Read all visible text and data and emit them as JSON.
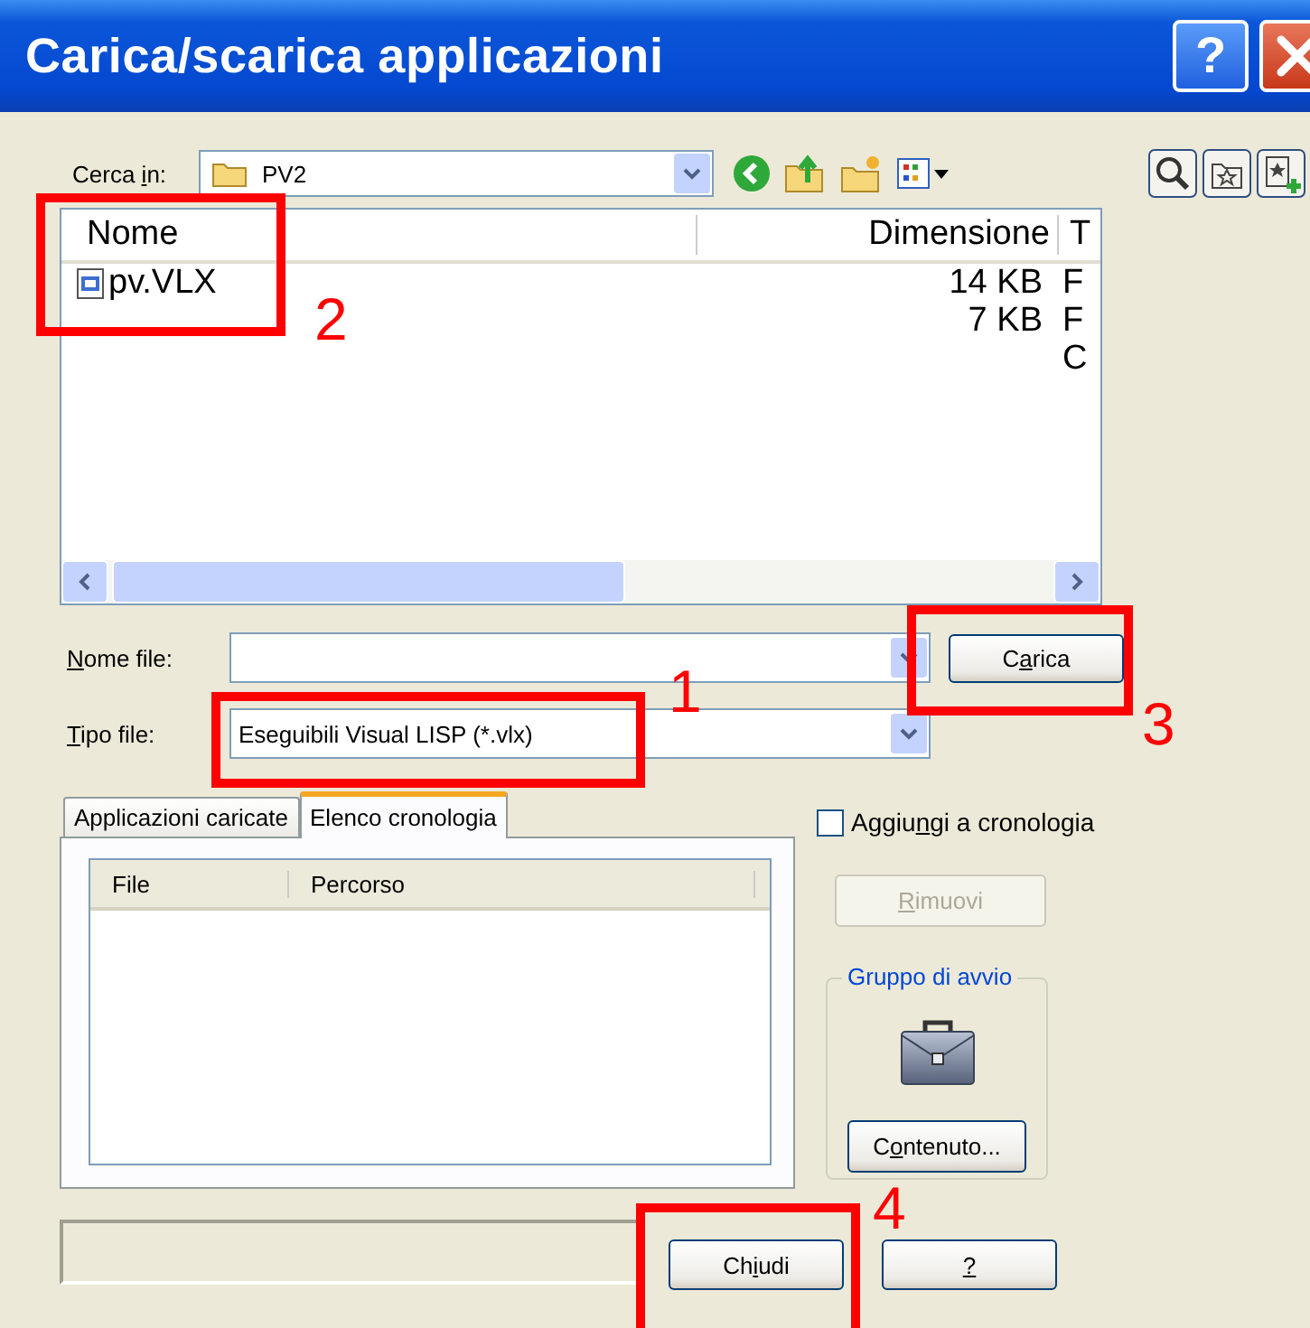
{
  "window": {
    "title": "Carica/scarica applicazioni",
    "help_button": "?"
  },
  "look_in": {
    "label": "Cerca in:",
    "value": "PV2"
  },
  "file_list": {
    "columns": [
      "Nome",
      "Dimensione",
      "T"
    ],
    "rows": [
      {
        "name": "pv.VLX",
        "size": "14 KB",
        "type": "F"
      },
      {
        "size": "7 KB",
        "type": "F"
      },
      {
        "type": "C"
      }
    ]
  },
  "file_name": {
    "label": "Nome file:"
  },
  "file_type": {
    "label": "Tipo file:",
    "value": "Eseguibili Visual LISP (*.vlx)"
  },
  "load_button": {
    "label": "Carica"
  },
  "tabs": [
    {
      "label": "Applicazioni caricate",
      "selected": false
    },
    {
      "label": "Elenco cronologia",
      "selected": true
    }
  ],
  "history_list": {
    "columns": [
      "File",
      "Percorso"
    ]
  },
  "add_to_history": {
    "label": "Aggiungi a cronologia",
    "checked": false
  },
  "remove_button": {
    "label": "Rimuovi",
    "disabled": true
  },
  "startup_group": {
    "title": "Gruppo di avvio",
    "button": {
      "label": "Contenuto..."
    }
  },
  "bottom_buttons": [
    {
      "label": "Chiudi"
    },
    {
      "label": "?"
    }
  ],
  "annotations": [
    {
      "number": "1"
    },
    {
      "number": "2"
    },
    {
      "number": "3"
    },
    {
      "number": "4"
    }
  ]
}
